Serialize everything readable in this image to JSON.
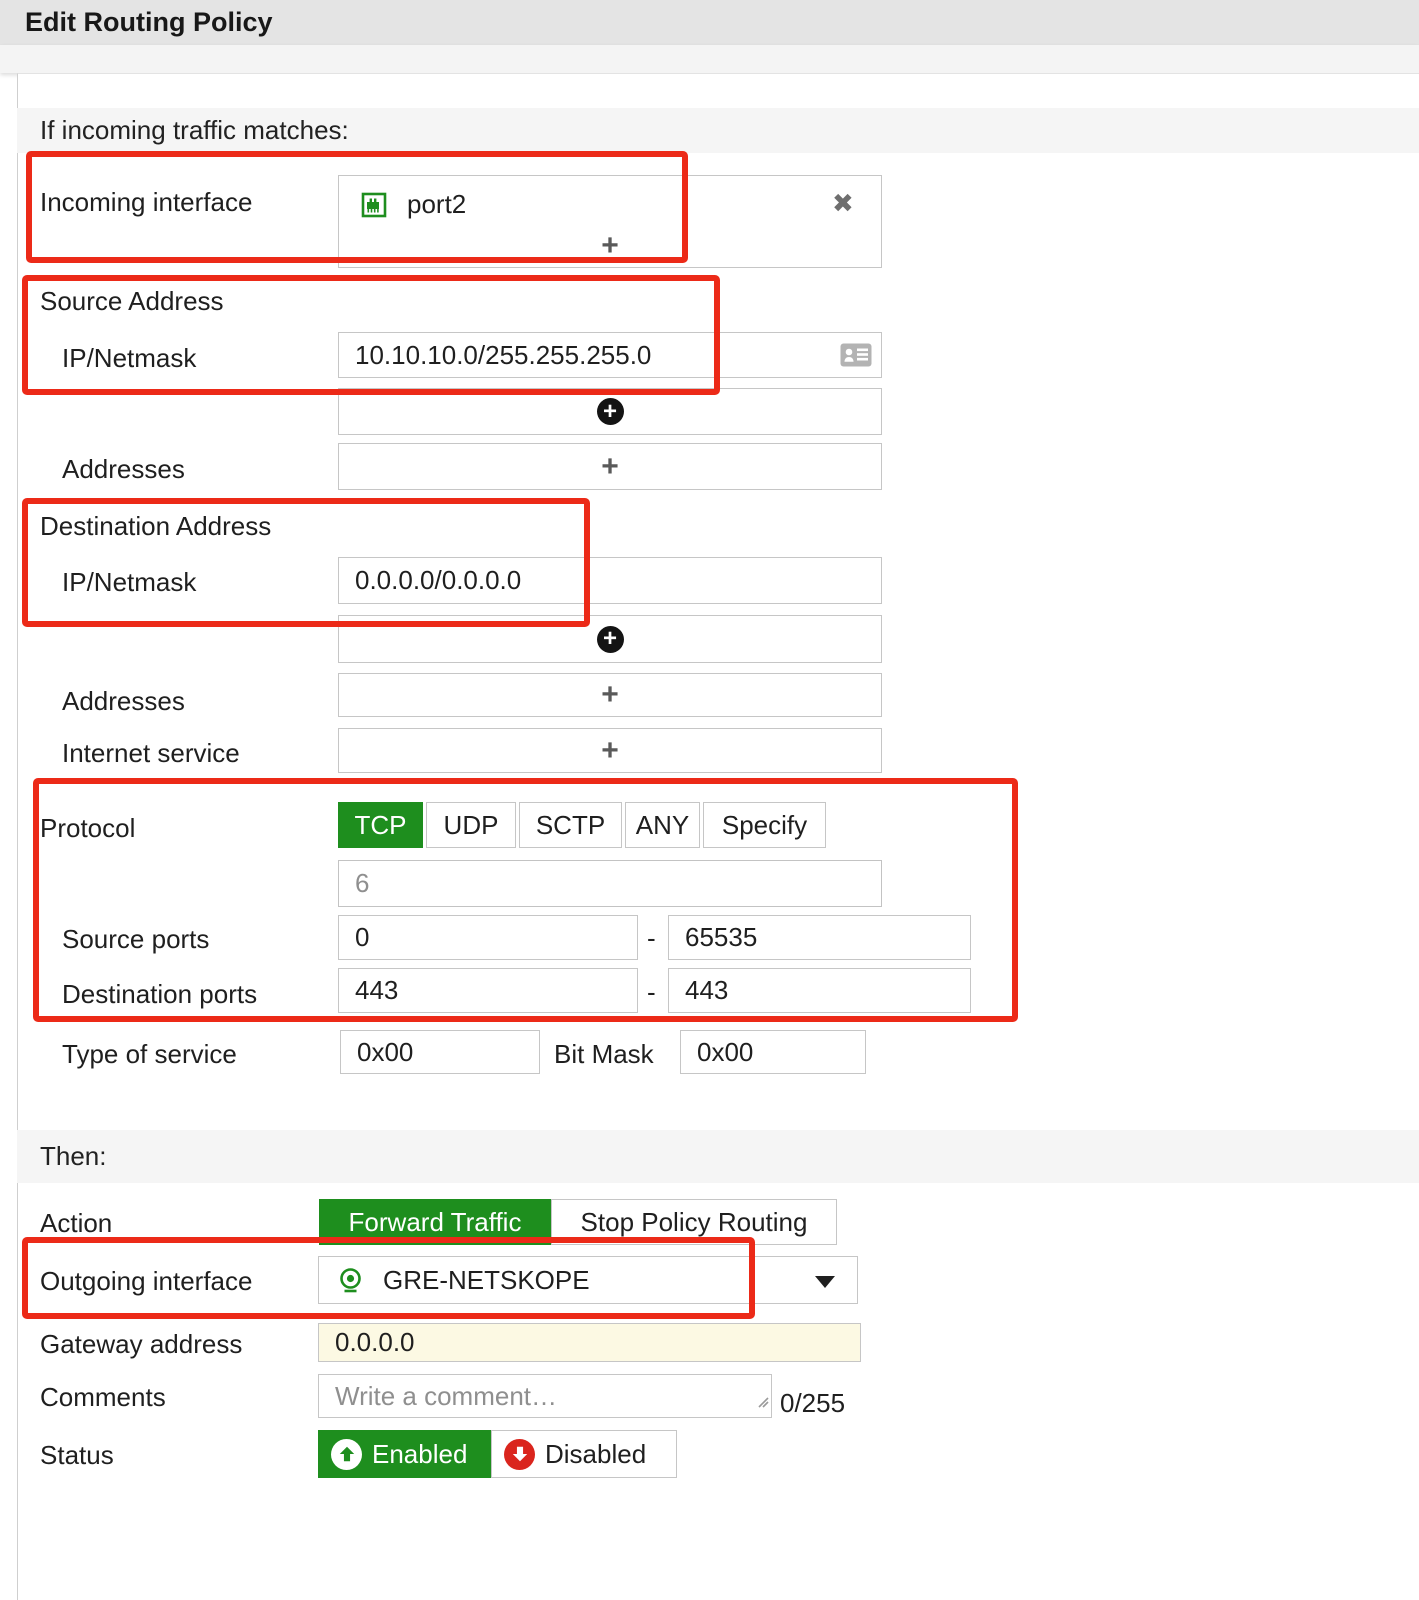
{
  "title_bar": {
    "title": "Edit Routing Policy"
  },
  "colors": {
    "accent_green": "#1e8e1e",
    "status_red": "#da251d",
    "annotation_red": "#ec2a18",
    "gateway_field_bg": "#fcf9e3"
  },
  "match_section": {
    "heading": "If incoming traffic matches:",
    "incoming_interface": {
      "label": "Incoming interface",
      "selected": "port2",
      "add_button": "+",
      "remove_icon": "✖"
    },
    "source_address": {
      "heading": "Source Address",
      "ip_netmask_label": "IP/Netmask",
      "ip_netmask_value": "10.10.10.0/255.255.255.0",
      "add_row_button": "+",
      "addresses_label": "Addresses",
      "addresses_add_button": "+"
    },
    "destination_address": {
      "heading": "Destination Address",
      "ip_netmask_label": "IP/Netmask",
      "ip_netmask_value": "0.0.0.0/0.0.0.0",
      "add_row_button": "+",
      "addresses_label": "Addresses",
      "addresses_add_button": "+"
    },
    "internet_service": {
      "label": "Internet service",
      "add_button": "+"
    },
    "protocol": {
      "label": "Protocol",
      "options": [
        "TCP",
        "UDP",
        "SCTP",
        "ANY",
        "Specify"
      ],
      "selected": "TCP",
      "protocol_number": "6"
    },
    "source_ports": {
      "label": "Source ports",
      "from": "0",
      "separator": "-",
      "to": "65535"
    },
    "destination_ports": {
      "label": "Destination ports",
      "from": "443",
      "separator": "-",
      "to": "443"
    },
    "type_of_service": {
      "label": "Type of service",
      "value": "0x00",
      "bit_mask_label": "Bit Mask",
      "bit_mask_value": "0x00"
    }
  },
  "then_section": {
    "heading": "Then:",
    "action": {
      "label": "Action",
      "options": [
        "Forward Traffic",
        "Stop Policy Routing"
      ],
      "selected": "Forward Traffic"
    },
    "outgoing_interface": {
      "label": "Outgoing interface",
      "selected": "GRE-NETSKOPE"
    },
    "gateway_address": {
      "label": "Gateway address",
      "value": "0.0.0.0"
    },
    "comments": {
      "label": "Comments",
      "placeholder": "Write a comment…",
      "char_counter": "0/255"
    },
    "status": {
      "label": "Status",
      "options": [
        "Enabled",
        "Disabled"
      ],
      "selected": "Enabled"
    }
  }
}
